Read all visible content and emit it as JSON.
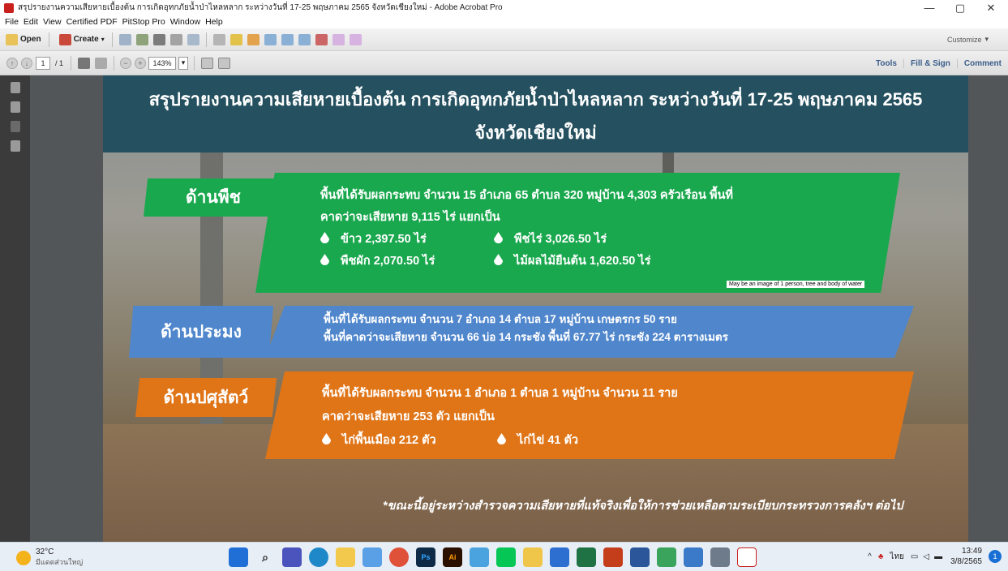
{
  "window": {
    "title": "สรุปรายงานความเสียหายเบื้องต้น การเกิดอุทกภัยน้ำป่าไหลหลาก ระหว่างวันที่ 17-25 พฤษภาคม 2565 จังหวัดเชียงใหม่ - Adobe Acrobat Pro",
    "minimize": "—",
    "restore": "▢",
    "close": "✕"
  },
  "menu": [
    "File",
    "Edit",
    "View",
    "Certified PDF",
    "PitStop Pro",
    "Window",
    "Help"
  ],
  "toolbar": {
    "open_label": "Open",
    "create_label": "Create",
    "customize_label": "Customize"
  },
  "nav": {
    "page_current": "1",
    "page_total": "/ 1",
    "zoom": "143%",
    "links": [
      "Tools",
      "Fill & Sign",
      "Comment"
    ]
  },
  "document": {
    "title_line1": "สรุปรายงานความเสียหายเบื้องต้น การเกิดอุทกภัยน้ำป่าไหลหลาก ระหว่างวันที่ 17-25 พฤษภาคม 2565",
    "title_line2": "จังหวัดเชียงใหม่",
    "crops": {
      "label": "ด้านพืช",
      "line1": "พื้นที่ได้รับผลกระทบ จำนวน 15 อำเภอ 65 ตำบล 320 หมู่บ้าน 4,303 ครัวเรือน พื้นที่",
      "line2": "คาดว่าจะเสียหาย  9,115 ไร่ แยกเป็น",
      "item1": "ข้าว 2,397.50 ไร่",
      "item2": "พืชไร่ 3,026.50 ไร่",
      "item3": "พืชผัก 2,070.50 ไร่",
      "item4": "ไม้ผลไม้ยืนต้น 1,620.50 ไร่",
      "alt_tooltip": "May be an image of 1 person, tree and body of water",
      "color": "#1aa84e"
    },
    "fishery": {
      "label": "ด้านประมง",
      "line1": "พื้นที่ได้รับผลกระทบ จำนวน 7  อำเภอ 14 ตำบล 17 หมู่บ้าน เกษตรกร 50 ราย",
      "line2": "พื้นที่คาดว่าจะเสียหาย  จำนวน 66 บ่อ  14 กระชัง  พื้นที่ 67.77 ไร่  กระชัง  224  ตารางเมตร",
      "color": "#4f86cc"
    },
    "livestock": {
      "label": "ด้านปศุสัตว์",
      "line1": "พื้นที่ได้รับผลกระทบ จำนวน  1 อำเภอ  1 ตำบล 1 หมู่บ้าน จำนวน 11 ราย",
      "line2": "คาดว่าจะเสียหาย  253 ตัว แยกเป็น",
      "item1": "ไก่พื้นเมือง 212 ตัว",
      "item2": "ไก่ไข่ 41 ตัว",
      "color": "#e07518"
    },
    "footnote": "*ขณะนี้อยู่ระหว่างสำรวจความเสียหายที่แท้จริงเพื่อให้การช่วยเหลือตามระเบียบกระทรวงการคลังฯ ต่อไป"
  },
  "taskbar": {
    "temperature": "32°C",
    "weather_desc": "มีแดดส่วนใหญ่",
    "ps_label": "Ps",
    "ai_label": "Ai",
    "ime": "ไทย",
    "time": "13:49",
    "date": "3/8/2565",
    "notification_count": "1"
  }
}
